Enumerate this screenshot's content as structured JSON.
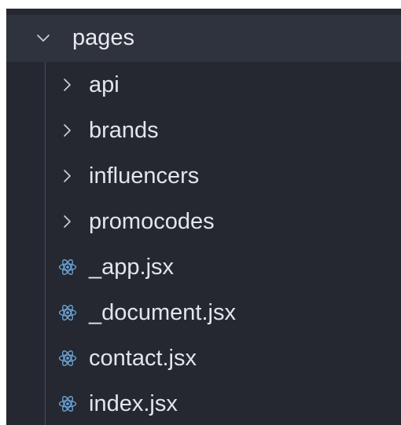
{
  "explorer": {
    "folder": {
      "name": "pages",
      "icon": "chevron-down-icon",
      "expanded": true
    },
    "items": [
      {
        "label": "api",
        "type": "folder",
        "icon": "chevron-right-icon",
        "expanded": false
      },
      {
        "label": "brands",
        "type": "folder",
        "icon": "chevron-right-icon",
        "expanded": false
      },
      {
        "label": "influencers",
        "type": "folder",
        "icon": "chevron-right-icon",
        "expanded": false
      },
      {
        "label": "promocodes",
        "type": "folder",
        "icon": "chevron-right-icon",
        "expanded": false
      },
      {
        "label": "_app.jsx",
        "type": "file",
        "icon": "react-icon"
      },
      {
        "label": "_document.jsx",
        "type": "file",
        "icon": "react-icon"
      },
      {
        "label": "contact.jsx",
        "type": "file",
        "icon": "react-icon"
      },
      {
        "label": "index.jsx",
        "type": "file",
        "icon": "react-icon"
      }
    ]
  },
  "colors": {
    "panel_bg": "#252831",
    "folder_header_bg": "#2f333d",
    "text": "#e3e5eb",
    "react_icon": "#6fa8dc",
    "indent_guide": "#4a4e58"
  }
}
